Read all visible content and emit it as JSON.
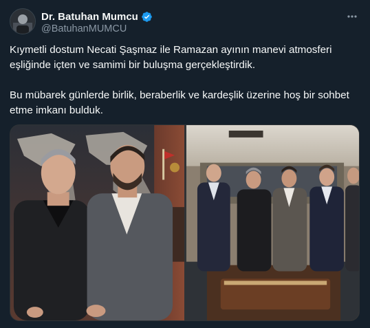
{
  "tweet": {
    "author": {
      "display_name": "Dr. Batuhan Mumcu",
      "handle": "@BatuhanMUMCU",
      "verified": true,
      "verified_icon": "verified-badge-icon",
      "avatar_icon": "avatar-photo"
    },
    "menu_icon": "more-options-icon",
    "text": {
      "paragraph_1": "Kıymetli dostum Necati Şaşmaz ile Ramazan ayının manevi atmosferi eşliğinde içten ve samimi bir buluşma gerçekleştirdik.",
      "paragraph_2": "Bu mübarek günlerde birlik, beraberlik ve kardeşlik üzerine hoş bir sohbet etme imkanı bulduk."
    },
    "media": [
      {
        "kind": "photo",
        "subject": "two-men-in-office"
      },
      {
        "kind": "photo",
        "subject": "group-of-five-men-in-office"
      }
    ]
  },
  "colors": {
    "background": "#15202b",
    "primary_text": "#f7f9f9",
    "secondary_text": "#8b98a5",
    "verified_blue": "#1d9bf0",
    "border": "#2f3336"
  }
}
